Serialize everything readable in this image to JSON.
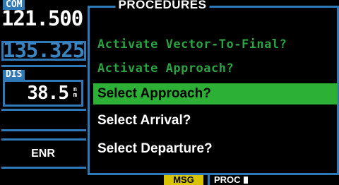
{
  "com": {
    "label": "COM",
    "active_frequency": "121.500",
    "standby_frequency": "135.325"
  },
  "distance": {
    "label": "DIS",
    "value": "38.5",
    "unit_top": "n",
    "unit_bottom": "m"
  },
  "cdi_mode": "ENR",
  "procedures": {
    "title": "PROCEDURES",
    "items": [
      {
        "label": "Activate Vector-To-Final?",
        "state": "unavailable"
      },
      {
        "label": "Activate Approach?",
        "state": "unavailable"
      },
      {
        "label": "Select Approach?",
        "state": "selected"
      },
      {
        "label": "Select Arrival?",
        "state": "available"
      },
      {
        "label": "Select Departure?",
        "state": "available"
      }
    ]
  },
  "status_bar": {
    "msg_label": "MSG",
    "page_label": "PROC"
  },
  "colors": {
    "frame_blue": "#2f79b7",
    "highlight_green": "#2cb035",
    "dim_green": "#29a33f",
    "msg_yellow": "#d8c300"
  }
}
